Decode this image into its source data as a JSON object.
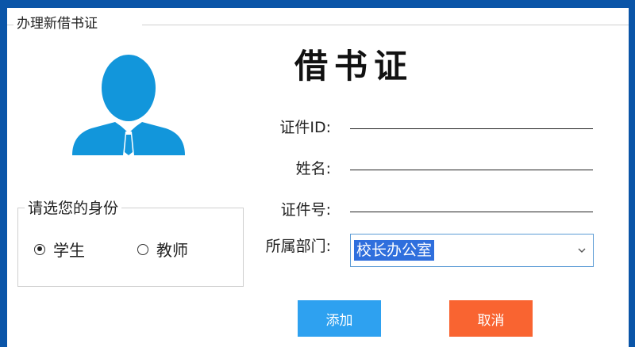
{
  "window": {
    "group_title": "办理新借书证"
  },
  "card": {
    "title": "借书证"
  },
  "identity": {
    "title": "请选您的身份",
    "options": [
      {
        "label": "学生",
        "checked": true
      },
      {
        "label": "教师",
        "checked": false
      }
    ]
  },
  "form": {
    "id_label": "证件ID:",
    "name_label": "姓名:",
    "number_label": "证件号:",
    "dept_label": "所属部门:",
    "id_value": "",
    "name_value": "",
    "number_value": "",
    "dept_value": "校长办公室"
  },
  "buttons": {
    "add": "添加",
    "cancel": "取消"
  },
  "colors": {
    "frame": "#0a55a8",
    "avatar": "#1296db",
    "add_button": "#2ea1f0",
    "cancel_button": "#f96431",
    "selection": "#2f6fdd"
  },
  "icons": {
    "avatar": "user-avatar-icon",
    "dropdown": "chevron-down-icon"
  }
}
